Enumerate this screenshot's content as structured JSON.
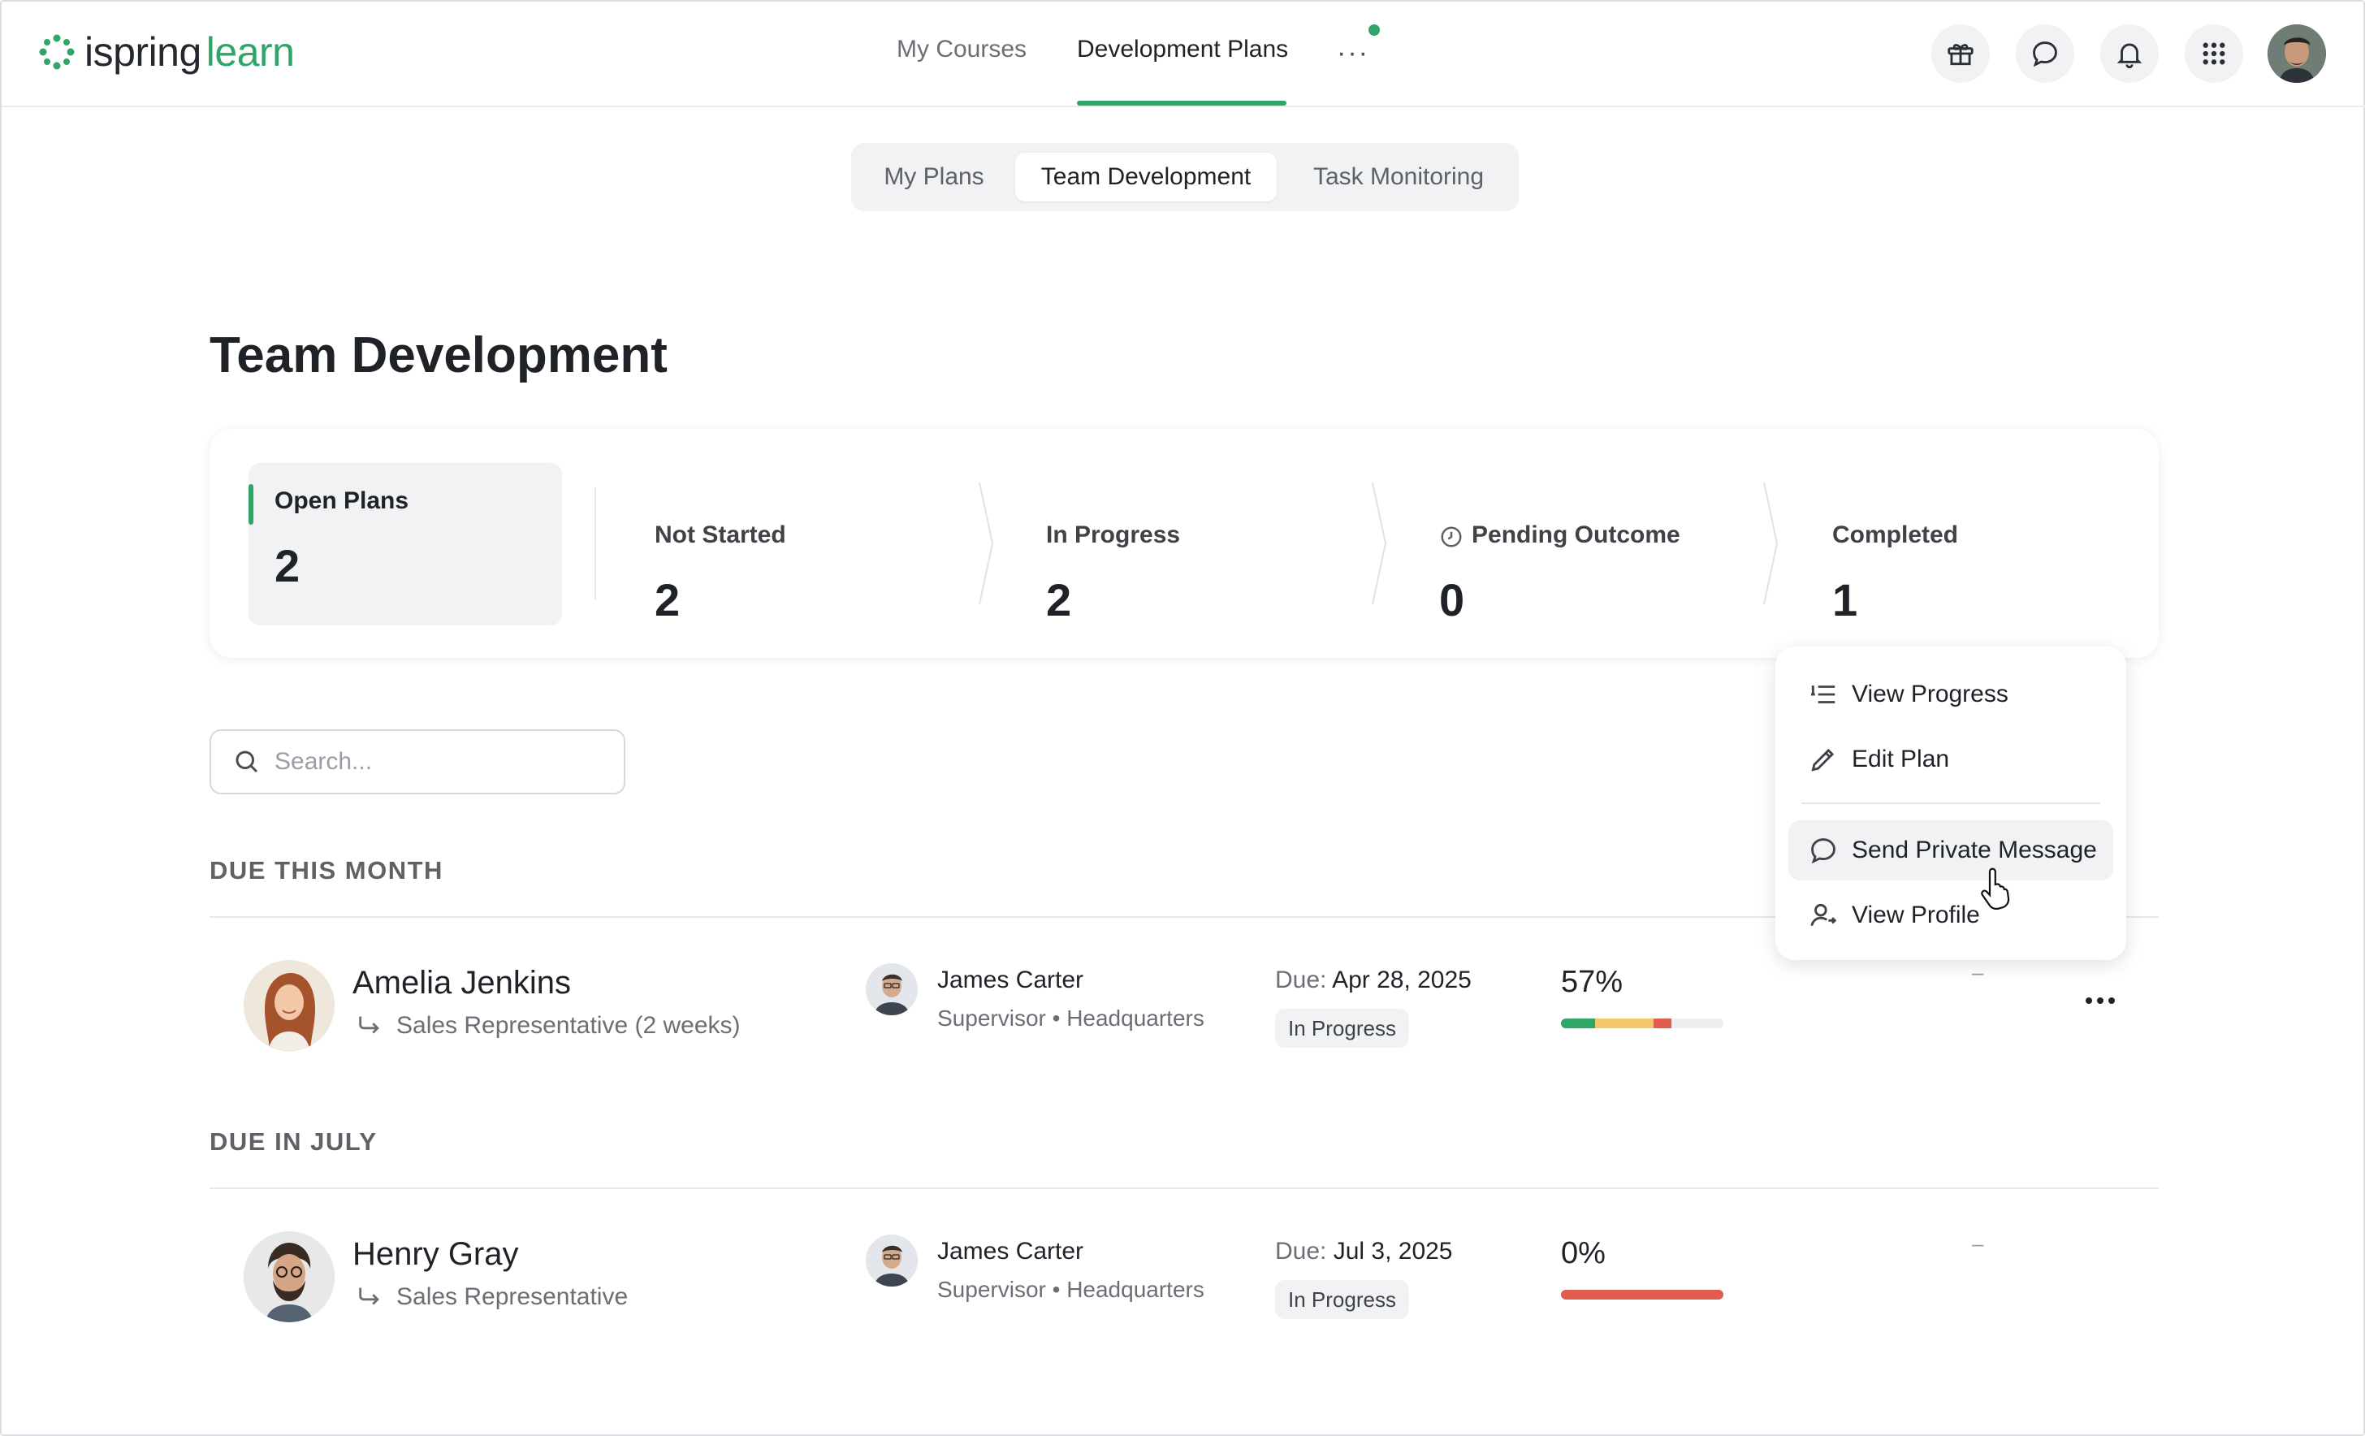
{
  "brand": {
    "word1": "ispring",
    "word2": "learn",
    "color": "#2fa568"
  },
  "nav": {
    "items": [
      {
        "label": "My Courses",
        "active": false
      },
      {
        "label": "Development Plans",
        "active": true
      }
    ],
    "more_label": "···"
  },
  "header_icons": [
    "gift-icon",
    "chat-icon",
    "bell-icon",
    "apps-grid-icon",
    "user-avatar"
  ],
  "tabs": [
    {
      "label": "My Plans",
      "active": false
    },
    {
      "label": "Team Development",
      "active": true
    },
    {
      "label": "Task Monitoring",
      "active": false
    }
  ],
  "page_title": "Team Development",
  "summary": {
    "open": {
      "label": "Open Plans",
      "value": "2"
    },
    "not_started": {
      "label": "Not Started",
      "value": "2"
    },
    "in_progress": {
      "label": "In Progress",
      "value": "2"
    },
    "pending": {
      "label": "Pending Outcome",
      "value": "0"
    },
    "completed": {
      "label": "Completed",
      "value": "1"
    }
  },
  "search": {
    "placeholder": "Search..."
  },
  "sections": [
    {
      "title": "DUE THIS MONTH",
      "rows": [
        {
          "name": "Amelia Jenkins",
          "role": "Sales Representative (2 weeks)",
          "supervisor_name": "James Carter",
          "supervisor_role": "Supervisor • Headquarters",
          "due_label": "Due:",
          "due_date": "Apr 28, 2025",
          "status": "In Progress",
          "progress_text": "57%",
          "progress": 0.57,
          "dash": "–"
        }
      ]
    },
    {
      "title": "DUE IN JULY",
      "rows": [
        {
          "name": "Henry Gray",
          "role": "Sales Representative",
          "supervisor_name": "James Carter",
          "supervisor_role": "Supervisor • Headquarters",
          "due_label": "Due:",
          "due_date": "Jul 3, 2025",
          "status": "In Progress",
          "progress_text": "0%",
          "progress": 0,
          "dash": "–"
        }
      ]
    }
  ],
  "context_menu": {
    "items": [
      {
        "label": "View Progress",
        "icon": "list-numbered-icon"
      },
      {
        "label": "Edit Plan",
        "icon": "pencil-icon"
      },
      {
        "label": "Send Private Message",
        "icon": "chat-bubble-icon",
        "hovered": true
      },
      {
        "label": "View Profile",
        "icon": "user-profile-icon"
      }
    ]
  }
}
